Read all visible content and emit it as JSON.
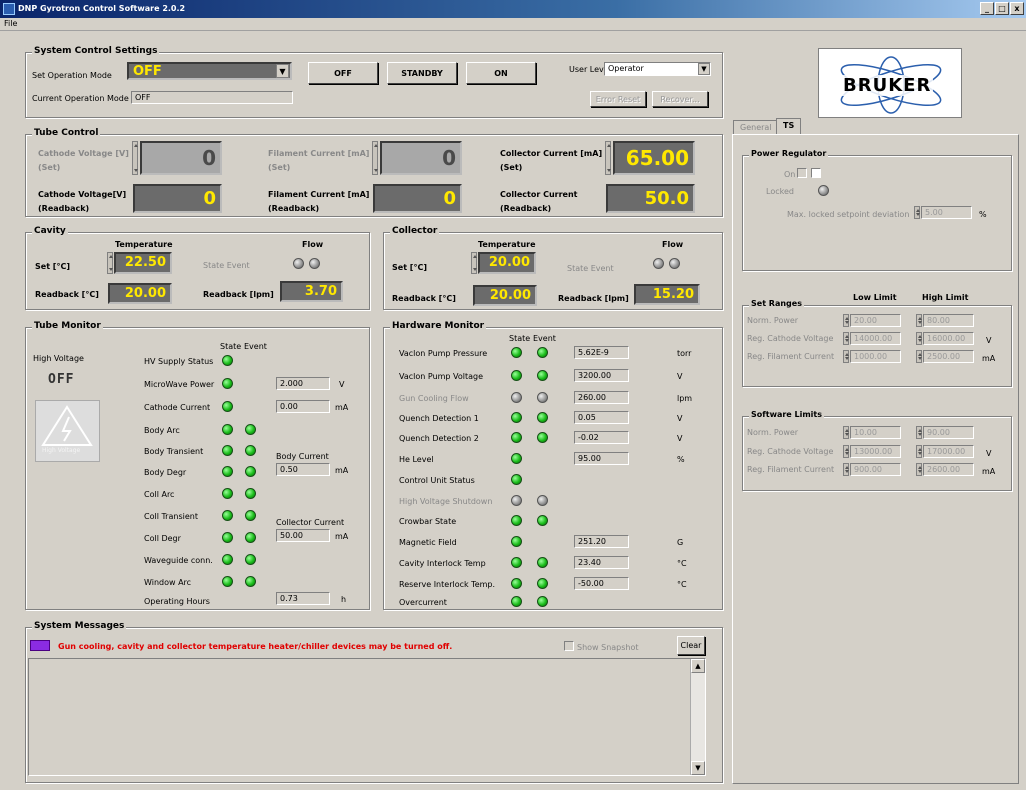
{
  "window": {
    "title": "DNP Gyrotron Control Software 2.0.2",
    "minimize": "_",
    "maximize": "□",
    "close": "x"
  },
  "menu": {
    "file": "File"
  },
  "system_control": {
    "title": "System Control Settings",
    "set_mode_label": "Set Operation Mode",
    "set_mode_value": "OFF",
    "current_mode_label": "Current Operation Mode",
    "current_mode_value": "OFF",
    "btn_off": "OFF",
    "btn_standby": "STANDBY",
    "btn_on": "ON",
    "user_level_label": "User Level",
    "user_level_value": "Operator",
    "error_reset": "Error Reset",
    "recover": "Recover..."
  },
  "logo": {
    "text": "BRUKER"
  },
  "tube_control": {
    "title": "Tube Control",
    "cathode_set_label": "Cathode Voltage [V]",
    "set_sub": "(Set)",
    "cathode_set_value": "0",
    "filament_set_label": "Filament Current [mA]",
    "filament_set_value": "0",
    "collector_set_label": "Collector Current [mA]",
    "collector_set_value": "65.00",
    "cathode_rb_label": "Cathode Voltage[V]",
    "readback_sub": "(Readback)",
    "cathode_rb_value": "0",
    "filament_rb_label": "Filament Current [mA]",
    "filament_rb_value": "0",
    "collector_rb_label": "Collector Current",
    "collector_rb_value": "50.0"
  },
  "cavity": {
    "title": "Cavity",
    "temperature": "Temperature",
    "flow": "Flow",
    "set_label": "Set [°C]",
    "set_value": "22.50",
    "state_event": "State Event",
    "readback_label": "Readback [°C]",
    "readback_value": "20.00",
    "flow_label": "Readback [lpm]",
    "flow_value": "3.70"
  },
  "collector": {
    "title": "Collector",
    "temperature": "Temperature",
    "flow": "Flow",
    "set_label": "Set [°C]",
    "set_value": "20.00",
    "state_event": "State Event",
    "readback_label": "Readback [°C]",
    "readback_value": "20.00",
    "flow_label": "Readback [lpm]",
    "flow_value": "15.20"
  },
  "tube_monitor": {
    "title": "Tube Monitor",
    "hv_label": "High Voltage",
    "hv_value": "OFF",
    "hv_icon_text": "High Voltage",
    "state": "State",
    "event": "Event",
    "rows": [
      "HV Supply Status",
      "MicroWave Power",
      "Cathode Current",
      "Body Arc",
      "Body Transient",
      "Body Degr",
      "Coll Arc",
      "Coll Transient",
      "Coll Degr",
      "Waveguide conn.",
      "Window Arc",
      "Operating Hours"
    ],
    "mw_value": "2.000",
    "mw_unit": "V",
    "cathode_value": "0.00",
    "cathode_unit": "mA",
    "body_current_label": "Body Current",
    "body_current_value": "0.50",
    "body_current_unit": "mA",
    "collector_current_label": "Collector Current",
    "collector_current_value": "50.00",
    "collector_current_unit": "mA",
    "hours_value": "0.73",
    "hours_unit": "h"
  },
  "hardware_monitor": {
    "title": "Hardware Monitor",
    "state": "State",
    "event": "Event",
    "rows": [
      {
        "label": "Vaclon Pump Pressure",
        "value": "5.62E-9",
        "unit": "torr"
      },
      {
        "label": "Vaclon Pump Voltage",
        "value": "3200.00",
        "unit": "V"
      },
      {
        "label": "Gun Cooling Flow",
        "value": "260.00",
        "unit": "lpm"
      },
      {
        "label": "Quench Detection 1",
        "value": "0.05",
        "unit": "V"
      },
      {
        "label": "Quench Detection 2",
        "value": "-0.02",
        "unit": "V"
      },
      {
        "label": "He Level",
        "value": "95.00",
        "unit": "%"
      },
      {
        "label": "Control Unit Status",
        "value": "",
        "unit": ""
      },
      {
        "label": "High Voltage Shutdown",
        "value": "",
        "unit": ""
      },
      {
        "label": "Crowbar State",
        "value": "",
        "unit": ""
      },
      {
        "label": "Magnetic Field",
        "value": "251.20",
        "unit": "G"
      },
      {
        "label": "Cavity Interlock Temp",
        "value": "23.40",
        "unit": "°C"
      },
      {
        "label": "Reserve Interlock Temp.",
        "value": "-50.00",
        "unit": "°C"
      },
      {
        "label": "Overcurrent",
        "value": "",
        "unit": ""
      }
    ]
  },
  "messages": {
    "title": "System Messages",
    "text": "Gun cooling, cavity and collector temperature heater/chiller devices may be turned off.",
    "show_snapshot": "Show Snapshot",
    "clear": "Clear"
  },
  "tabs": {
    "general": "General",
    "ts": "TS"
  },
  "power_regulator": {
    "title": "Power Regulator",
    "on": "On",
    "locked": "Locked",
    "max_dev_label": "Max. locked setpoint deviation",
    "max_dev_value": "5.00",
    "max_dev_unit": "%"
  },
  "set_ranges": {
    "title": "Set Ranges",
    "low": "Low Limit",
    "high": "High Limit",
    "rows": [
      {
        "label": "Norm. Power",
        "low": "20.00",
        "high": "80.00",
        "unit": ""
      },
      {
        "label": "Reg. Cathode Voltage",
        "low": "14000.00",
        "high": "16000.00",
        "unit": "V"
      },
      {
        "label": "Reg. Filament Current",
        "low": "1000.00",
        "high": "2500.00",
        "unit": "mA"
      }
    ]
  },
  "software_limits": {
    "title": "Software Limits",
    "rows": [
      {
        "label": "Norm. Power",
        "low": "10.00",
        "high": "90.00",
        "unit": ""
      },
      {
        "label": "Reg. Cathode Voltage",
        "low": "13000.00",
        "high": "17000.00",
        "unit": "V"
      },
      {
        "label": "Reg. Filament Current",
        "low": "900.00",
        "high": "2600.00",
        "unit": "mA"
      }
    ]
  },
  "colors": {
    "accent_yellow": "#ffe800",
    "led_green": "#1bbd1b",
    "message_red": "#e00000",
    "message_icon": "#8a2be2"
  }
}
